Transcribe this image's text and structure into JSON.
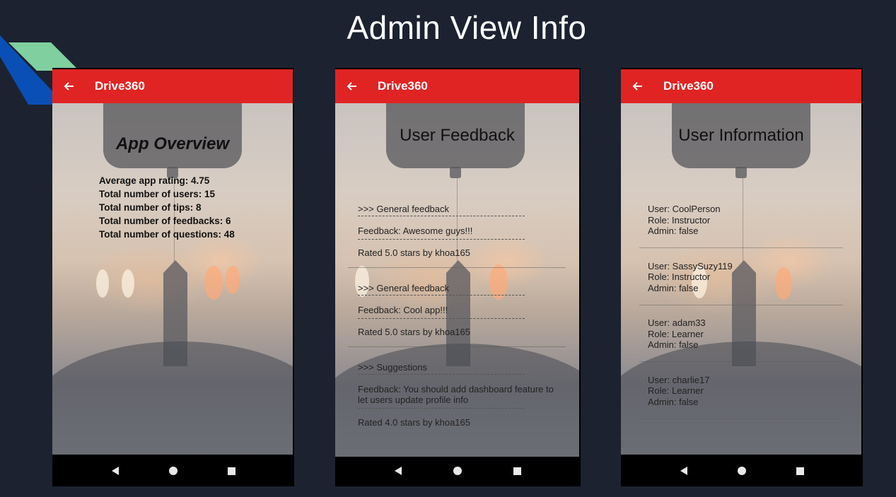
{
  "slide": {
    "title": "Admin View Info"
  },
  "colors": {
    "app_bar": "#e02424",
    "slide_background": "#1c2230",
    "deco_green": "#7fcf9f",
    "deco_blue": "#0a4fb5"
  },
  "app": {
    "name": "Drive360",
    "back_icon": "arrow-left-icon"
  },
  "overview": {
    "heading": "App Overview",
    "stats": [
      "Average app rating: 4.75",
      "Total number of users: 15",
      "Total number of tips: 8",
      "Total number of feedbacks: 6",
      "Total number of questions: 48"
    ]
  },
  "feedback": {
    "heading": "User Feedback",
    "items": [
      {
        "type": ">>> General feedback",
        "text": "Feedback: Awesome guys!!!",
        "rating": "Rated 5.0 stars by khoa165"
      },
      {
        "type": ">>> General feedback",
        "text": "Feedback: Cool app!!!",
        "rating": "Rated 5.0 stars by khoa165"
      },
      {
        "type": ">>> Suggestions",
        "text": "Feedback: You should add dashboard feature to let users update profile info",
        "rating": "Rated 4.0 stars by khoa165"
      }
    ]
  },
  "users": {
    "heading": "User Information",
    "items": [
      {
        "user": "User: CoolPerson",
        "role": "Role: Instructor",
        "admin": "Admin: false"
      },
      {
        "user": "User: SassySuzy119",
        "role": "Role: Instructor",
        "admin": "Admin: false"
      },
      {
        "user": "User: adam33",
        "role": "Role: Learner",
        "admin": "Admin: false"
      },
      {
        "user": "User: charlie17",
        "role": "Role: Learner",
        "admin": "Admin: false"
      }
    ]
  },
  "navbar": {
    "icons": [
      "nav-back-icon",
      "nav-home-icon",
      "nav-recent-icon"
    ]
  }
}
